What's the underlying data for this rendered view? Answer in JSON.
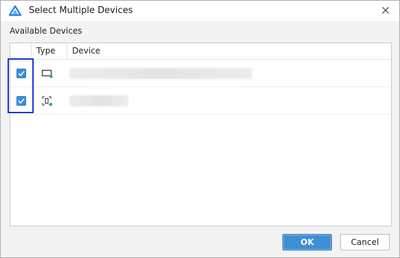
{
  "window": {
    "title": "Select Multiple Devices",
    "logo_icon": "deveco-logo-icon",
    "close_icon": "close-icon"
  },
  "section": {
    "label": "Available Devices"
  },
  "table": {
    "columns": [
      "",
      "Type",
      "Device"
    ],
    "rows": [
      {
        "checked": true,
        "type_icon": "monitor-device-icon",
        "device": ""
      },
      {
        "checked": true,
        "type_icon": "phone-device-icon",
        "device": ""
      }
    ]
  },
  "footer": {
    "ok_label": "OK",
    "cancel_label": "Cancel"
  },
  "colors": {
    "accent": "#3d8fd9",
    "highlight": "#1533d6",
    "online_dot": "#34b04a"
  }
}
